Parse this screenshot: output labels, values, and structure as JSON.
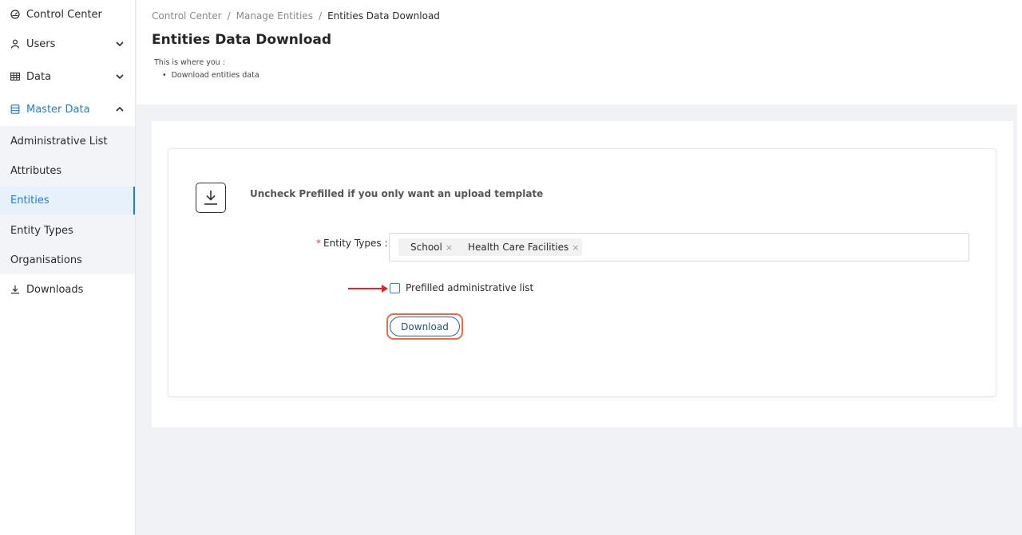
{
  "sidebar": {
    "control_center": "Control Center",
    "users": "Users",
    "data": "Data",
    "master_data": "Master Data",
    "sub_items": [
      "Administrative List",
      "Attributes",
      "Entities",
      "Entity Types",
      "Organisations"
    ],
    "downloads": "Downloads"
  },
  "breadcrumb": {
    "items": [
      "Control Center",
      "Manage Entities",
      "Entities Data Download"
    ],
    "separator": "/"
  },
  "page": {
    "title": "Entities Data Download",
    "intro": "This is where you :",
    "bullets": [
      "Download entities data"
    ]
  },
  "form": {
    "hint": "Uncheck Prefilled if you only want an upload template",
    "required_mark": "*",
    "entity_types_label": "Entity Types :",
    "tags": [
      "School",
      "Health Care Facilities"
    ],
    "tag_remove_glyph": "×",
    "checkbox_label": "Prefilled administrative list",
    "checkbox_checked": false,
    "download_button": "Download"
  },
  "colors": {
    "accent": "#1e7fd6",
    "annotation_red": "#e02424",
    "highlight_orange": "#ee6b45"
  },
  "icons": {
    "control_center": "dashboard-icon",
    "users": "user-icon",
    "data": "table-icon",
    "master_data": "database-icon",
    "downloads": "download-icon",
    "expand": "chevron-down-icon",
    "collapse": "chevron-up-icon",
    "form": "download-box-icon"
  }
}
